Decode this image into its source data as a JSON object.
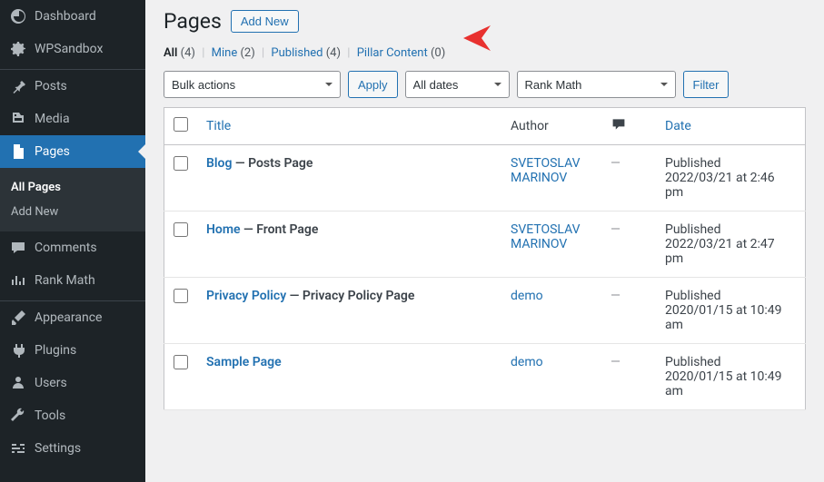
{
  "sidebar": {
    "items": [
      {
        "label": "Dashboard",
        "icon": "dashboard"
      },
      {
        "label": "WPSandbox",
        "icon": "gear"
      },
      {
        "label": "Posts",
        "icon": "pin"
      },
      {
        "label": "Media",
        "icon": "media"
      },
      {
        "label": "Pages",
        "icon": "page"
      },
      {
        "label": "Comments",
        "icon": "comment"
      },
      {
        "label": "Rank Math",
        "icon": "chart"
      },
      {
        "label": "Appearance",
        "icon": "brush"
      },
      {
        "label": "Plugins",
        "icon": "plug"
      },
      {
        "label": "Users",
        "icon": "user"
      },
      {
        "label": "Tools",
        "icon": "wrench"
      },
      {
        "label": "Settings",
        "icon": "sliders"
      }
    ],
    "sub": {
      "all_pages": "All Pages",
      "add_new": "Add New"
    }
  },
  "header": {
    "title": "Pages",
    "add_new": "Add New"
  },
  "filters": {
    "all_label": "All",
    "all_count": "(4)",
    "mine_label": "Mine",
    "mine_count": "(2)",
    "published_label": "Published",
    "published_count": "(4)",
    "pillar_label": "Pillar Content",
    "pillar_count": "(0)"
  },
  "controls": {
    "bulk": "Bulk actions",
    "apply": "Apply",
    "dates": "All dates",
    "rank": "Rank Math",
    "filter": "Filter"
  },
  "table": {
    "headers": {
      "title": "Title",
      "author": "Author",
      "date": "Date"
    },
    "rows": [
      {
        "title": "Blog",
        "suffix": " — Posts Page",
        "author": "SVETOSLAV MARINOV",
        "status": "Published",
        "date": "2022/03/21 at 2:46 pm"
      },
      {
        "title": "Home",
        "suffix": " — Front Page",
        "author": "SVETOSLAV MARINOV",
        "status": "Published",
        "date": "2022/03/21 at 2:47 pm"
      },
      {
        "title": "Privacy Policy",
        "suffix": " — Privacy Policy Page",
        "author": "demo",
        "status": "Published",
        "date": "2020/01/15 at 10:49 am"
      },
      {
        "title": "Sample Page",
        "suffix": "",
        "author": "demo",
        "status": "Published",
        "date": "2020/01/15 at 10:49 am"
      }
    ]
  }
}
